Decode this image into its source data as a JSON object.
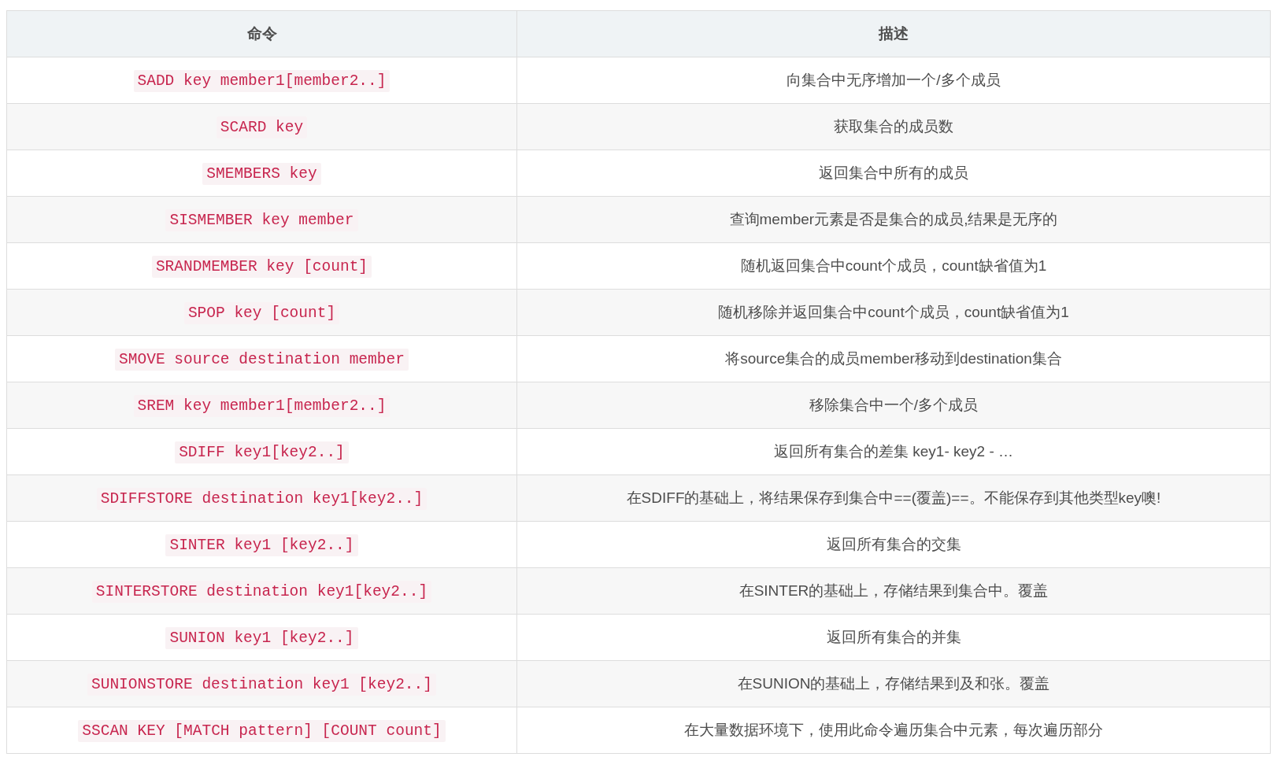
{
  "table": {
    "columns": [
      "命令",
      "描述"
    ],
    "rows": [
      {
        "command": "SADD key member1[member2..]",
        "description": "向集合中无序增加一个/多个成员"
      },
      {
        "command": "SCARD key",
        "description": "获取集合的成员数"
      },
      {
        "command": "SMEMBERS key",
        "description": "返回集合中所有的成员"
      },
      {
        "command": "SISMEMBER key member",
        "description": "查询member元素是否是集合的成员,结果是无序的"
      },
      {
        "command": "SRANDMEMBER key [count]",
        "description": "随机返回集合中count个成员，count缺省值为1"
      },
      {
        "command": "SPOP key [count]",
        "description": "随机移除并返回集合中count个成员，count缺省值为1"
      },
      {
        "command": "SMOVE source destination member",
        "description": "将source集合的成员member移动到destination集合"
      },
      {
        "command": "SREM key member1[member2..]",
        "description": "移除集合中一个/多个成员"
      },
      {
        "command": "SDIFF key1[key2..]",
        "description": "返回所有集合的差集 key1- key2 - …"
      },
      {
        "command": "SDIFFSTORE destination key1[key2..]",
        "description": "在SDIFF的基础上，将结果保存到集合中==(覆盖)==。不能保存到其他类型key噢!"
      },
      {
        "command": "SINTER key1 [key2..]",
        "description": "返回所有集合的交集"
      },
      {
        "command": "SINTERSTORE destination key1[key2..]",
        "description": "在SINTER的基础上，存储结果到集合中。覆盖"
      },
      {
        "command": "SUNION key1 [key2..]",
        "description": "返回所有集合的并集"
      },
      {
        "command": "SUNIONSTORE destination key1 [key2..]",
        "description": "在SUNION的基础上，存储结果到及和张。覆盖"
      },
      {
        "command": "SSCAN KEY [MATCH pattern] [COUNT count]",
        "description": "在大量数据环境下，使用此命令遍历集合中元素，每次遍历部分"
      }
    ]
  }
}
